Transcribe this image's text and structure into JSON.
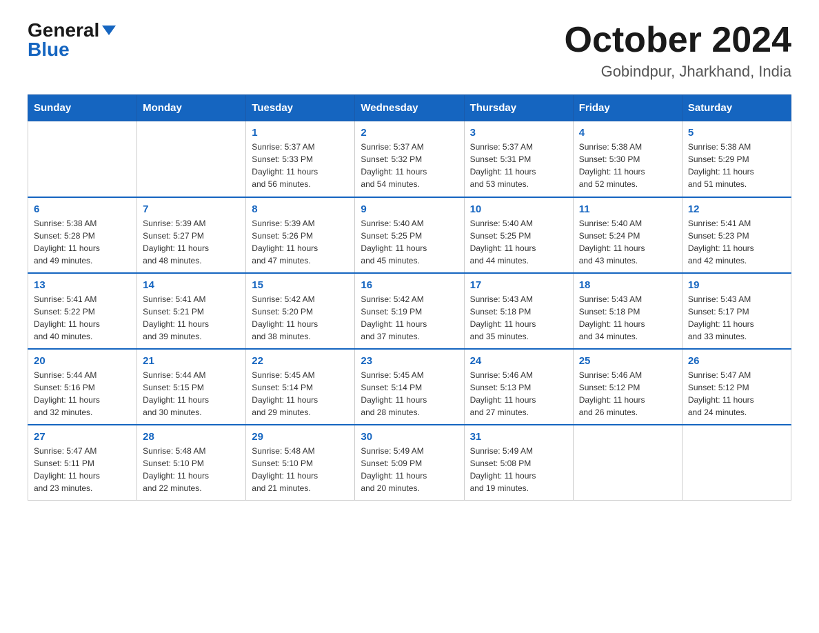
{
  "header": {
    "logo_general": "General",
    "logo_blue": "Blue",
    "month_title": "October 2024",
    "location": "Gobindpur, Jharkhand, India"
  },
  "days_of_week": [
    "Sunday",
    "Monday",
    "Tuesday",
    "Wednesday",
    "Thursday",
    "Friday",
    "Saturday"
  ],
  "weeks": [
    [
      {
        "day": "",
        "info": ""
      },
      {
        "day": "",
        "info": ""
      },
      {
        "day": "1",
        "info": "Sunrise: 5:37 AM\nSunset: 5:33 PM\nDaylight: 11 hours\nand 56 minutes."
      },
      {
        "day": "2",
        "info": "Sunrise: 5:37 AM\nSunset: 5:32 PM\nDaylight: 11 hours\nand 54 minutes."
      },
      {
        "day": "3",
        "info": "Sunrise: 5:37 AM\nSunset: 5:31 PM\nDaylight: 11 hours\nand 53 minutes."
      },
      {
        "day": "4",
        "info": "Sunrise: 5:38 AM\nSunset: 5:30 PM\nDaylight: 11 hours\nand 52 minutes."
      },
      {
        "day": "5",
        "info": "Sunrise: 5:38 AM\nSunset: 5:29 PM\nDaylight: 11 hours\nand 51 minutes."
      }
    ],
    [
      {
        "day": "6",
        "info": "Sunrise: 5:38 AM\nSunset: 5:28 PM\nDaylight: 11 hours\nand 49 minutes."
      },
      {
        "day": "7",
        "info": "Sunrise: 5:39 AM\nSunset: 5:27 PM\nDaylight: 11 hours\nand 48 minutes."
      },
      {
        "day": "8",
        "info": "Sunrise: 5:39 AM\nSunset: 5:26 PM\nDaylight: 11 hours\nand 47 minutes."
      },
      {
        "day": "9",
        "info": "Sunrise: 5:40 AM\nSunset: 5:25 PM\nDaylight: 11 hours\nand 45 minutes."
      },
      {
        "day": "10",
        "info": "Sunrise: 5:40 AM\nSunset: 5:25 PM\nDaylight: 11 hours\nand 44 minutes."
      },
      {
        "day": "11",
        "info": "Sunrise: 5:40 AM\nSunset: 5:24 PM\nDaylight: 11 hours\nand 43 minutes."
      },
      {
        "day": "12",
        "info": "Sunrise: 5:41 AM\nSunset: 5:23 PM\nDaylight: 11 hours\nand 42 minutes."
      }
    ],
    [
      {
        "day": "13",
        "info": "Sunrise: 5:41 AM\nSunset: 5:22 PM\nDaylight: 11 hours\nand 40 minutes."
      },
      {
        "day": "14",
        "info": "Sunrise: 5:41 AM\nSunset: 5:21 PM\nDaylight: 11 hours\nand 39 minutes."
      },
      {
        "day": "15",
        "info": "Sunrise: 5:42 AM\nSunset: 5:20 PM\nDaylight: 11 hours\nand 38 minutes."
      },
      {
        "day": "16",
        "info": "Sunrise: 5:42 AM\nSunset: 5:19 PM\nDaylight: 11 hours\nand 37 minutes."
      },
      {
        "day": "17",
        "info": "Sunrise: 5:43 AM\nSunset: 5:18 PM\nDaylight: 11 hours\nand 35 minutes."
      },
      {
        "day": "18",
        "info": "Sunrise: 5:43 AM\nSunset: 5:18 PM\nDaylight: 11 hours\nand 34 minutes."
      },
      {
        "day": "19",
        "info": "Sunrise: 5:43 AM\nSunset: 5:17 PM\nDaylight: 11 hours\nand 33 minutes."
      }
    ],
    [
      {
        "day": "20",
        "info": "Sunrise: 5:44 AM\nSunset: 5:16 PM\nDaylight: 11 hours\nand 32 minutes."
      },
      {
        "day": "21",
        "info": "Sunrise: 5:44 AM\nSunset: 5:15 PM\nDaylight: 11 hours\nand 30 minutes."
      },
      {
        "day": "22",
        "info": "Sunrise: 5:45 AM\nSunset: 5:14 PM\nDaylight: 11 hours\nand 29 minutes."
      },
      {
        "day": "23",
        "info": "Sunrise: 5:45 AM\nSunset: 5:14 PM\nDaylight: 11 hours\nand 28 minutes."
      },
      {
        "day": "24",
        "info": "Sunrise: 5:46 AM\nSunset: 5:13 PM\nDaylight: 11 hours\nand 27 minutes."
      },
      {
        "day": "25",
        "info": "Sunrise: 5:46 AM\nSunset: 5:12 PM\nDaylight: 11 hours\nand 26 minutes."
      },
      {
        "day": "26",
        "info": "Sunrise: 5:47 AM\nSunset: 5:12 PM\nDaylight: 11 hours\nand 24 minutes."
      }
    ],
    [
      {
        "day": "27",
        "info": "Sunrise: 5:47 AM\nSunset: 5:11 PM\nDaylight: 11 hours\nand 23 minutes."
      },
      {
        "day": "28",
        "info": "Sunrise: 5:48 AM\nSunset: 5:10 PM\nDaylight: 11 hours\nand 22 minutes."
      },
      {
        "day": "29",
        "info": "Sunrise: 5:48 AM\nSunset: 5:10 PM\nDaylight: 11 hours\nand 21 minutes."
      },
      {
        "day": "30",
        "info": "Sunrise: 5:49 AM\nSunset: 5:09 PM\nDaylight: 11 hours\nand 20 minutes."
      },
      {
        "day": "31",
        "info": "Sunrise: 5:49 AM\nSunset: 5:08 PM\nDaylight: 11 hours\nand 19 minutes."
      },
      {
        "day": "",
        "info": ""
      },
      {
        "day": "",
        "info": ""
      }
    ]
  ]
}
